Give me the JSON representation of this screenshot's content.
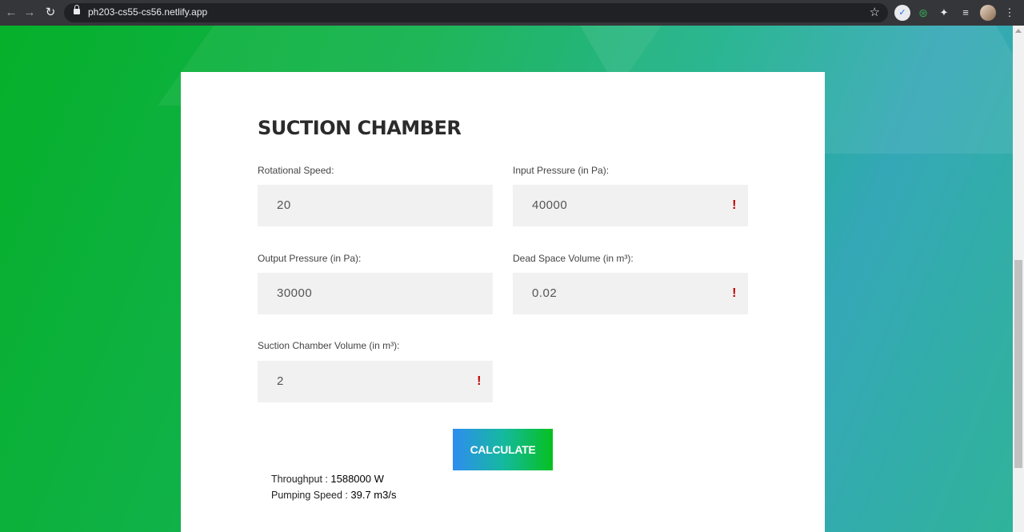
{
  "browser": {
    "url": "ph203-cs55-cs56.netlify.app",
    "icons": [
      "back-icon",
      "forward-icon",
      "reload-icon",
      "lock-icon",
      "star-icon",
      "extension-icon",
      "wifi-icon",
      "puzzle-icon",
      "queue-icon",
      "avatar-icon",
      "menu-icon"
    ]
  },
  "form": {
    "title": "SUCTION CHAMBER",
    "rotational_speed": {
      "label": "Rotational Speed:",
      "value": "20"
    },
    "input_pressure": {
      "label": "Input Pressure (in Pa):",
      "value": "40000"
    },
    "output_pressure": {
      "label": "Output Pressure (in Pa):",
      "value": "30000"
    },
    "dead_space_volume": {
      "label": "Dead Space Volume (in m³):",
      "value": "0.02"
    },
    "suction_chamber_volume": {
      "label": "Suction Chamber Volume (in m³):",
      "value": "2"
    },
    "warning_mark": "!",
    "calculate_label": "CALCULATE"
  },
  "results": {
    "throughput_label": "Throughput :",
    "throughput_value": "1588000 W",
    "pumping_speed_label": "Pumping Speed :",
    "pumping_speed_value": "39.7 m3/s"
  },
  "colors": {
    "button_gradient_start": "#2f8cf0",
    "button_gradient_end": "#06c021",
    "warning": "#c00000",
    "background_green": "#06b02a",
    "background_teal": "#35a8b7"
  }
}
